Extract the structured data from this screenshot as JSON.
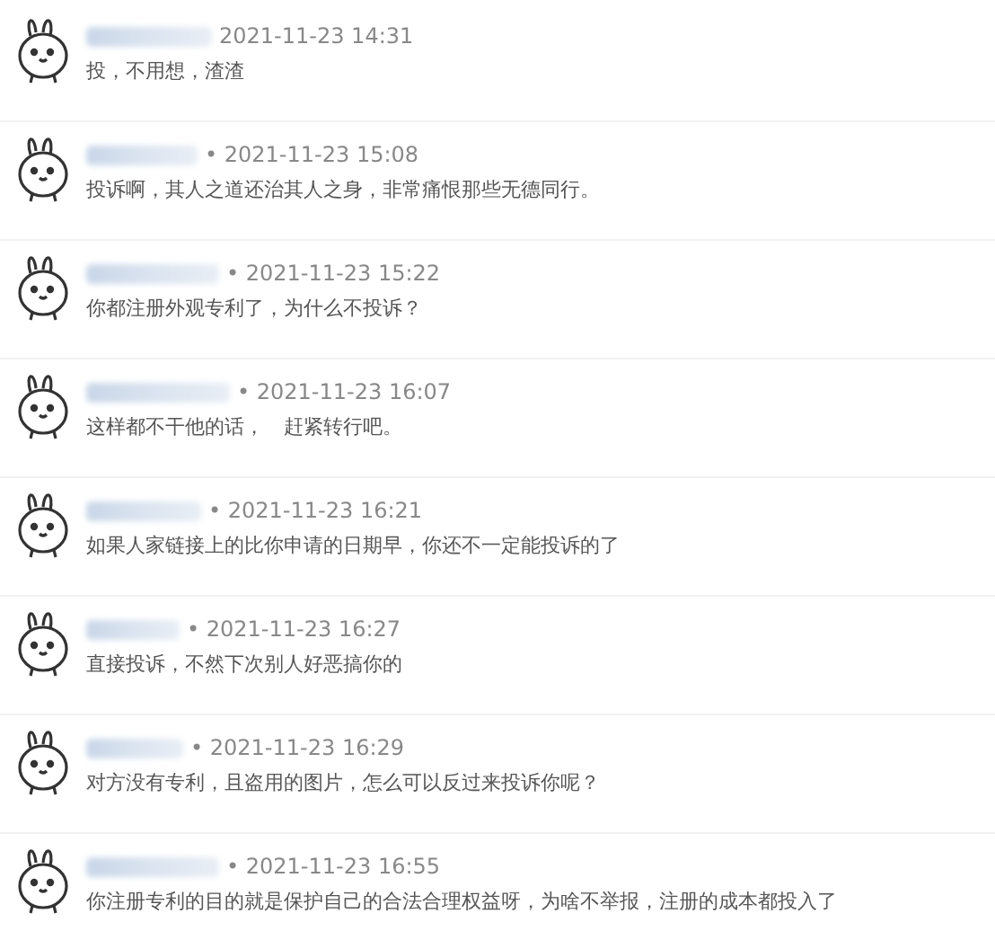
{
  "comments": [
    {
      "meta": "2021-11-23 14:31",
      "text": "投，不用想，渣渣"
    },
    {
      "meta": "• 2021-11-23 15:08",
      "text": "投诉啊，其人之道还治其人之身，非常痛恨那些无德同行。"
    },
    {
      "meta": "• 2021-11-23 15:22",
      "text": "你都注册外观专利了，为什么不投诉？"
    },
    {
      "meta": "• 2021-11-23 16:07",
      "text": "这样都不干他的话，　赶紧转行吧。"
    },
    {
      "meta": "• 2021-11-23 16:21",
      "text": "如果人家链接上的比你申请的日期早，你还不一定能投诉的了"
    },
    {
      "meta": "• 2021-11-23 16:27",
      "text": "直接投诉，不然下次别人好恶搞你的"
    },
    {
      "meta": "• 2021-11-23 16:29",
      "text": "对方没有专利，且盗用的图片，怎么可以反过来投诉你呢？"
    },
    {
      "meta": "• 2021-11-23 16:55",
      "text": "你注册专利的目的就是保护自己的合法合理权益呀，为啥不举报，注册的成本都投入了"
    }
  ]
}
